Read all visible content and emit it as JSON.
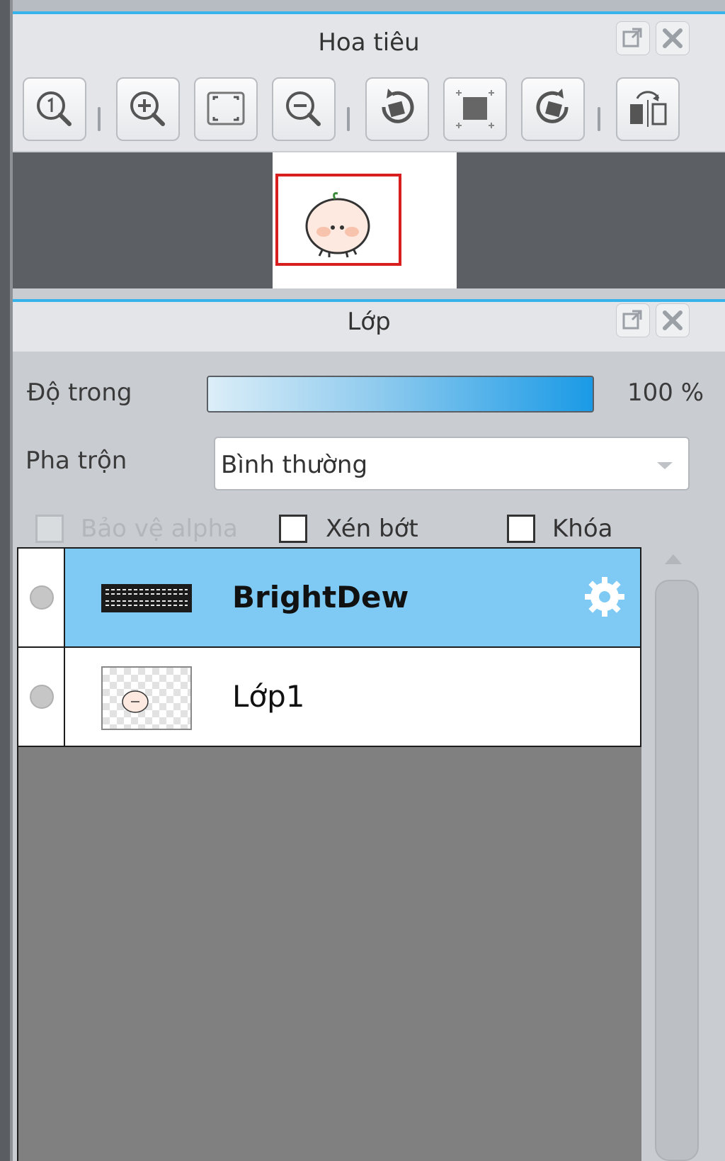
{
  "navigator": {
    "title": "Hoa tiêu",
    "window_buttons": [
      "undock-icon",
      "close-icon"
    ],
    "toolbar": [
      {
        "name": "zoom-actual-size-icon"
      },
      {
        "name": "zoom-in-icon"
      },
      {
        "name": "fit-to-window-icon"
      },
      {
        "name": "zoom-out-icon"
      },
      {
        "name": "rotate-left-icon"
      },
      {
        "name": "reset-rotation-icon"
      },
      {
        "name": "rotate-right-icon"
      },
      {
        "name": "flip-horizontal-icon"
      }
    ]
  },
  "layers": {
    "title": "Lớp",
    "opacity": {
      "label": "Độ trong",
      "value": 100,
      "value_text": "100 %"
    },
    "blend": {
      "label": "Pha trộn",
      "selected": "Bình thường"
    },
    "options": {
      "protect_alpha": {
        "label": "Bảo vệ alpha",
        "checked": false,
        "disabled": true
      },
      "clipping": {
        "label": "Xén bớt",
        "checked": false
      },
      "lock": {
        "label": "Khóa",
        "checked": false
      }
    },
    "list": [
      {
        "name": "BrightDew",
        "selected": true,
        "type": "text",
        "thumb_text": "BRIGHTDEW",
        "has_settings": true
      },
      {
        "name": "Lớp1",
        "selected": false,
        "type": "raster"
      }
    ],
    "colors": {
      "selected_row": "#7ecaf4",
      "accent": "#35b3ea",
      "empty_list": "#808080"
    }
  }
}
